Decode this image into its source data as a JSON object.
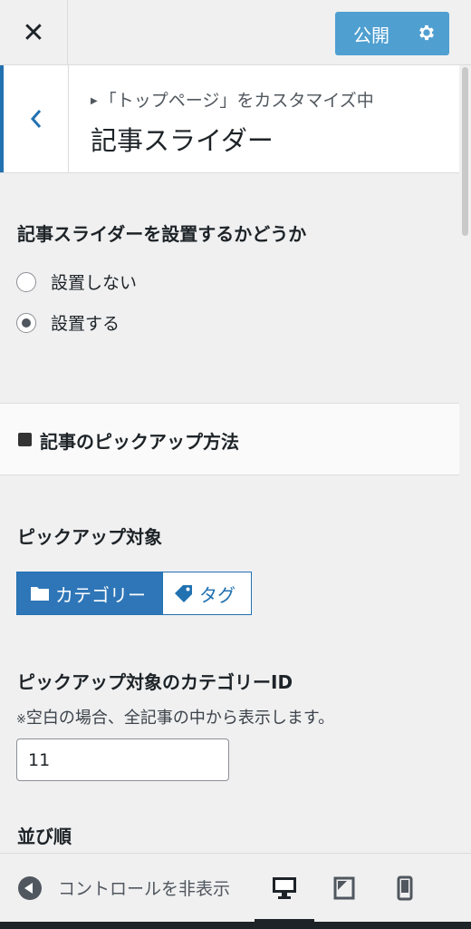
{
  "header": {
    "close_label": "✕",
    "publish_label": "公開"
  },
  "panel": {
    "breadcrumb": "「トップページ」をカスタマイズ中",
    "title": "記事スライダー"
  },
  "slider_setting": {
    "title": "記事スライダーを設置するかどうか",
    "options": [
      {
        "label": "設置しない",
        "selected": false
      },
      {
        "label": "設置する",
        "selected": true
      }
    ]
  },
  "pickup_section": {
    "title": "記事のピックアップ方法"
  },
  "pickup_target": {
    "title": "ピックアップ対象",
    "buttons": [
      {
        "label": "カテゴリー",
        "active": true,
        "icon": "folder-icon"
      },
      {
        "label": "タグ",
        "active": false,
        "icon": "tag-icon"
      }
    ]
  },
  "category_id": {
    "title": "ピックアップ対象のカテゴリーID",
    "note_mark": "※",
    "note": "空白の場合、全記事の中から表示します。",
    "value": "11"
  },
  "order": {
    "title": "並び順"
  },
  "footer": {
    "collapse_label": "コントロールを非表示"
  },
  "colors": {
    "accent": "#2271b1",
    "publish": "#4f9fd0"
  }
}
